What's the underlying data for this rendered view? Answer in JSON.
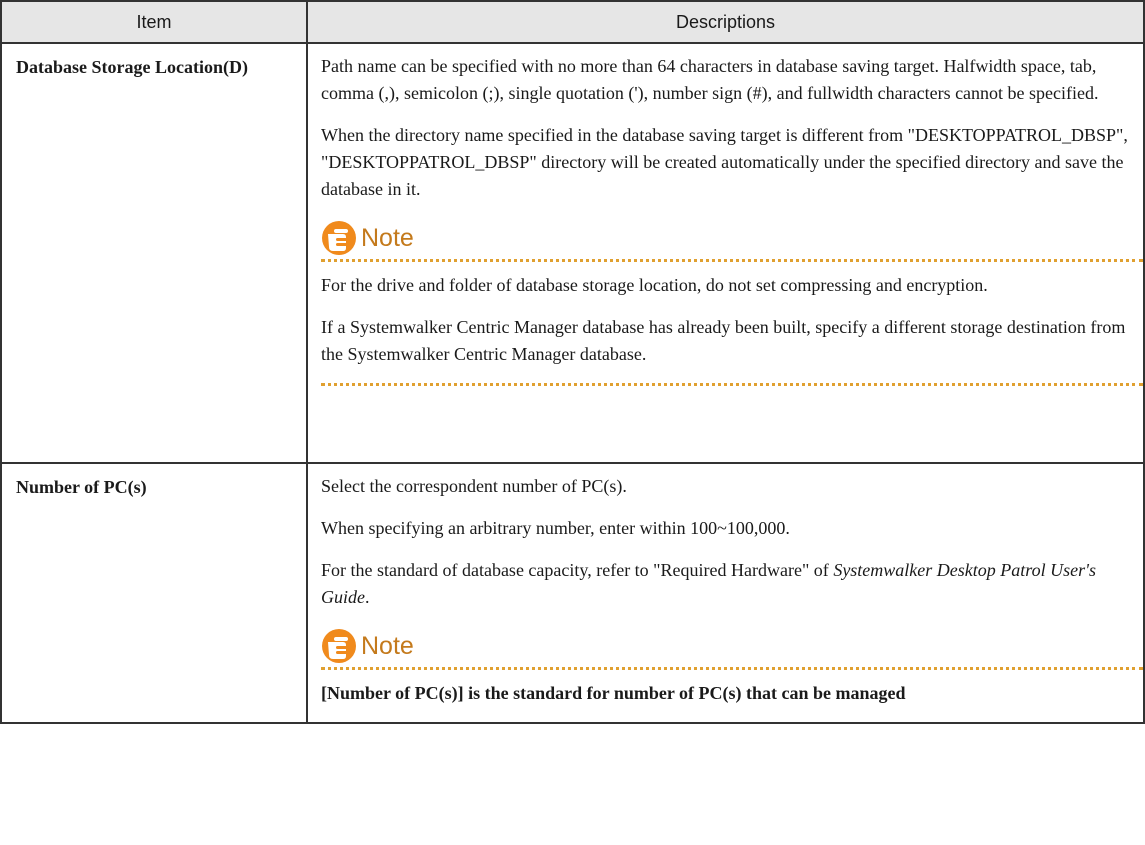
{
  "table": {
    "headers": {
      "item": "Item",
      "descriptions": "Descriptions"
    },
    "rows": [
      {
        "item": "Database Storage Location(D)",
        "paragraphs": [
          "Path name can be specified with no more than 64 characters in database saving target. Halfwidth space, tab, comma (,), semicolon (;), single quotation ('), number sign (#), and fullwidth characters cannot be specified.",
          "When the directory name specified in the database saving target is different from \"DESKTOPPATROL_DBSP\", \"DESKTOPPATROL_DBSP\" directory will be created automatically under the specified directory and save the database in it."
        ],
        "note": {
          "label": "Note",
          "paragraphs": [
            "For the drive and folder of database storage location, do not set compressing and encryption.",
            "If a Systemwalker Centric Manager database has already been built, specify a different storage destination from the Systemwalker Centric Manager database."
          ]
        }
      },
      {
        "item": "Number of PC(s)",
        "paragraphs": [
          "Select the correspondent number of PC(s).",
          "When specifying an arbitrary number, enter within 100~100,000."
        ],
        "ref_paragraph": {
          "before": "For the standard of database capacity, refer to \"Required Hardware\" of ",
          "italic": "Systemwalker Desktop Patrol User's Guide",
          "after": "."
        },
        "note": {
          "label": "Note",
          "paragraphs": [
            "[Number of PC(s)] is the standard for number of PC(s) that can be managed"
          ]
        }
      }
    ]
  },
  "colors": {
    "note_label": "#c47a1c",
    "dots": "#e0a030",
    "header_bg": "#e6e6e6",
    "icon": "#f08a1c"
  },
  "icons": {
    "note": "pointing-hand-icon"
  }
}
